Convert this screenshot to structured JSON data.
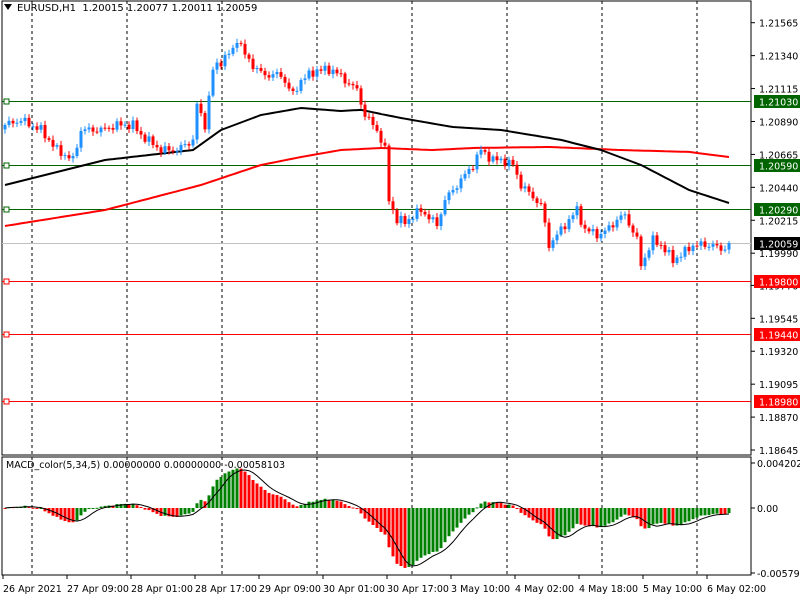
{
  "header": {
    "symbol": "EURUSD,H1",
    "open": "1.20015",
    "high": "1.20077",
    "low": "1.20011",
    "close": "1.20059"
  },
  "macd_header": {
    "name": "MACD_color(5,34,5)",
    "v1": "0.00000000",
    "v2": "0.00000000",
    "v3": "-0.00058103"
  },
  "colors": {
    "bull": "#1E90FF",
    "bear": "#FF0000",
    "ma_slow": "#FF0000",
    "ma_fast": "#000000",
    "level_green": "#006400",
    "level_red": "#FF0000",
    "hist_up": "#008000",
    "hist_down": "#FF0000"
  },
  "chart_data": {
    "type": "candlestick",
    "symbol": "EURUSD",
    "timeframe": "H1",
    "ylim": [
      1.18611,
      1.2172
    ],
    "price_ticks": [
      "1.21565",
      "1.21340",
      "1.21115",
      "1.20890",
      "1.20665",
      "1.20440",
      "1.20215",
      "1.19990",
      "1.19770",
      "1.19545",
      "1.19320",
      "1.19095",
      "1.18870",
      "1.18645"
    ],
    "levels": [
      {
        "price": "1.21030",
        "color": "green"
      },
      {
        "price": "1.20590",
        "color": "green"
      },
      {
        "price": "1.20290",
        "color": "green"
      },
      {
        "price": "1.19800",
        "color": "red"
      },
      {
        "price": "1.19440",
        "color": "red"
      },
      {
        "price": "1.18980",
        "color": "red"
      }
    ],
    "bid": "1.20059",
    "bar_count": 182,
    "time_ticks": [
      {
        "bar": 0,
        "label": "26 Apr 2021"
      },
      {
        "bar": 16,
        "label": "27 Apr 09:00"
      },
      {
        "bar": 32,
        "label": "28 Apr 01:00"
      },
      {
        "bar": 48,
        "label": "28 Apr 17:00"
      },
      {
        "bar": 64,
        "label": "29 Apr 09:00"
      },
      {
        "bar": 80,
        "label": "30 Apr 01:00"
      },
      {
        "bar": 96,
        "label": "30 Apr 17:00"
      },
      {
        "bar": 112,
        "label": "3 May 10:00"
      },
      {
        "bar": 128,
        "label": "4 May 02:00"
      },
      {
        "bar": 144,
        "label": "4 May 18:00"
      },
      {
        "bar": 160,
        "label": "5 May 10:00"
      },
      {
        "bar": 176,
        "label": "6 May 02:00"
      }
    ],
    "close_anchors": [
      [
        0,
        1.20866
      ],
      [
        4,
        1.209
      ],
      [
        9,
        1.20832
      ],
      [
        13,
        1.20695
      ],
      [
        17,
        1.20627
      ],
      [
        19,
        1.20832
      ],
      [
        24,
        1.20832
      ],
      [
        28,
        1.20866
      ],
      [
        32,
        1.20866
      ],
      [
        34,
        1.20798
      ],
      [
        39,
        1.20695
      ],
      [
        43,
        1.20695
      ],
      [
        47,
        1.20764
      ],
      [
        48,
        1.21003
      ],
      [
        50,
        1.20866
      ],
      [
        52,
        1.21242
      ],
      [
        53,
        1.21276
      ],
      [
        57,
        1.21378
      ],
      [
        58,
        1.2146
      ],
      [
        60,
        1.21344
      ],
      [
        63,
        1.21242
      ],
      [
        65,
        1.21208
      ],
      [
        69,
        1.21208
      ],
      [
        72,
        1.21071
      ],
      [
        74,
        1.21173
      ],
      [
        78,
        1.21242
      ],
      [
        82,
        1.21242
      ],
      [
        85,
        1.21173
      ],
      [
        88,
        1.21105
      ],
      [
        90,
        1.20934
      ],
      [
        93,
        1.20832
      ],
      [
        95,
        1.20695
      ],
      [
        96,
        1.20354
      ],
      [
        98,
        1.20217
      ],
      [
        100,
        1.20203
      ],
      [
        104,
        1.20285
      ],
      [
        108,
        1.20183
      ],
      [
        110,
        1.20354
      ],
      [
        114,
        1.2049
      ],
      [
        117,
        1.20593
      ],
      [
        119,
        1.20695
      ],
      [
        122,
        1.20627
      ],
      [
        124,
        1.20627
      ],
      [
        127,
        1.20593
      ],
      [
        129,
        1.20456
      ],
      [
        134,
        1.20319
      ],
      [
        136,
        1.20046
      ],
      [
        139,
        1.20149
      ],
      [
        143,
        1.20285
      ],
      [
        145,
        1.20149
      ],
      [
        149,
        1.20114
      ],
      [
        153,
        1.20217
      ],
      [
        155,
        1.20252
      ],
      [
        158,
        1.2008
      ],
      [
        159,
        1.19909
      ],
      [
        162,
        1.2008
      ],
      [
        164,
        1.20046
      ],
      [
        167,
        1.19943
      ],
      [
        169,
        1.19978
      ],
      [
        172,
        1.20046
      ],
      [
        174,
        1.20046
      ],
      [
        177,
        1.20046
      ],
      [
        179,
        1.20012
      ],
      [
        181,
        1.20059
      ]
    ],
    "ma_fast_anchors": [
      [
        0,
        1.20456
      ],
      [
        25,
        1.20627
      ],
      [
        47,
        1.20695
      ],
      [
        54,
        1.20832
      ],
      [
        64,
        1.20934
      ],
      [
        74,
        1.20982
      ],
      [
        84,
        1.20962
      ],
      [
        89,
        1.20969
      ],
      [
        99,
        1.20914
      ],
      [
        112,
        1.20852
      ],
      [
        124,
        1.20832
      ],
      [
        139,
        1.20764
      ],
      [
        149,
        1.20695
      ],
      [
        159,
        1.20593
      ],
      [
        171,
        1.20422
      ],
      [
        181,
        1.20333
      ]
    ],
    "ma_slow_anchors": [
      [
        0,
        1.20176
      ],
      [
        25,
        1.20285
      ],
      [
        49,
        1.20456
      ],
      [
        64,
        1.20593
      ],
      [
        74,
        1.20647
      ],
      [
        84,
        1.20695
      ],
      [
        94,
        1.20709
      ],
      [
        107,
        1.20695
      ],
      [
        117,
        1.20709
      ],
      [
        136,
        1.20716
      ],
      [
        154,
        1.20695
      ],
      [
        171,
        1.20682
      ],
      [
        181,
        1.20647
      ]
    ],
    "macd": {
      "title": "MACD_color(5,34,5)",
      "ticks": [
        "0.0042024",
        "0.00",
        "-0.005794"
      ],
      "ylim": [
        -0.005794,
        0.0042024
      ]
    }
  }
}
